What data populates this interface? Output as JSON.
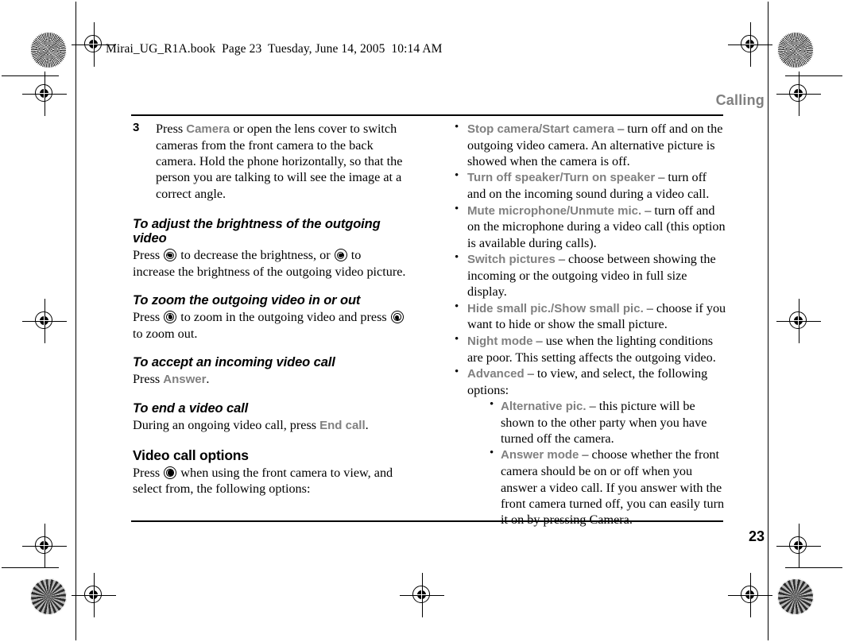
{
  "file_stamp": "Mirai_UG_R1A.book  Page 23  Tuesday, June 14, 2005  10:14 AM",
  "running_head": "Calling",
  "page_number": "23",
  "colors": {
    "keyword_gray": "#808080",
    "text_black": "#000000",
    "page_background": "#ffffff"
  },
  "left_column": {
    "step": {
      "number": "3",
      "text_before": "Press ",
      "keyword": "Camera",
      "text_after": " or open the lens cover to switch cameras from the front camera to the back camera. Hold the phone horizontally, so that the person you are talking to will see the image at a correct angle."
    },
    "sections": [
      {
        "heading": "To adjust the brightness of the outgoing video",
        "heading_style": "bold-italic",
        "body_1": "Press ",
        "icon_1": "nav-key-left-icon",
        "body_2": " to decrease the brightness, or ",
        "icon_2": "nav-key-right-icon",
        "body_3": " to increase the brightness of the outgoing video picture."
      },
      {
        "heading": "To zoom the outgoing video in or out",
        "heading_style": "bold-italic",
        "body_1": "Press ",
        "icon_1": "nav-key-up-icon",
        "body_2": " to zoom in the outgoing video and press ",
        "icon_2": "nav-key-down-icon",
        "body_3": " to zoom out."
      },
      {
        "heading": "To accept an incoming video call",
        "heading_style": "bold-italic",
        "body_1": "Press ",
        "keyword": "Answer",
        "body_3": "."
      },
      {
        "heading": "To end a video call",
        "heading_style": "bold-italic",
        "body_1": "During an ongoing video call, press ",
        "keyword": "End call",
        "body_3": "."
      },
      {
        "heading": "Video call options",
        "heading_style": "bold-upright",
        "body_1": "Press ",
        "icon_1": "select-key-icon",
        "body_2": " when using the front camera to view, and select from, the following options:"
      }
    ]
  },
  "right_column": {
    "options": [
      {
        "keyword": "Stop camera/Start camera",
        "description": " – turn off and on the outgoing video camera. An alternative picture is showed when the camera is off."
      },
      {
        "keyword": "Turn off speaker/Turn on speaker",
        "description": " – turn off and on the incoming sound during a video call."
      },
      {
        "keyword": "Mute microphone/Unmute mic.",
        "description": " – turn off and on the microphone during a video call (this option is available during calls)."
      },
      {
        "keyword": "Switch pictures",
        "description": " – choose between showing the incoming or the outgoing video in full size display."
      },
      {
        "keyword": "Hide small pic./Show small pic.",
        "description": " – choose if you want to hide or show the small picture."
      },
      {
        "keyword": "Night mode",
        "description": " – use when the lighting conditions are poor. This setting affects the outgoing video."
      },
      {
        "keyword": "Advanced",
        "description": " – to view, and select, the following options:"
      }
    ],
    "sub_options": [
      {
        "keyword": "Alternative pic.",
        "description": " – this picture will be shown to the other party when you have turned off the camera."
      },
      {
        "keyword": "Answer mode",
        "description": " – choose whether the front camera should be on or off when you answer a video call. If you answer with the front camera turned off, you can easily turn it on by pressing Camera."
      }
    ]
  }
}
